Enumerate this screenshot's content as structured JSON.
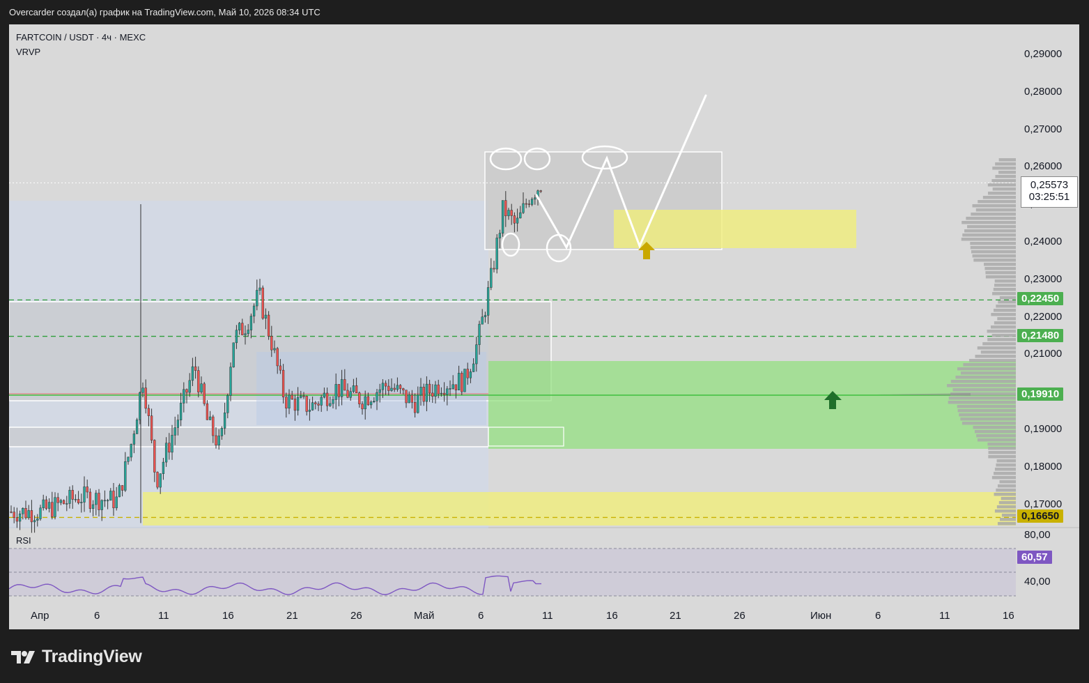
{
  "caption": "Overcarder создал(а) график на TradingView.com, Май 10, 2026 08:34 UTC",
  "symbol_title": "FARTCOIN / USDT · 4ч · MEXC",
  "indicator_label": "VRVP",
  "rsi_label": "RSI",
  "brand": "TradingView",
  "current_price": {
    "value": "0,25573",
    "countdown": "03:25:51"
  },
  "price_tags": [
    {
      "text": "0,22450",
      "price": 0.2245,
      "color": "#4caf50"
    },
    {
      "text": "0,21480",
      "price": 0.2148,
      "color": "#4caf50"
    },
    {
      "text": "0,19910",
      "price": 0.1991,
      "color": "#4caf50"
    },
    {
      "text": "0,16650",
      "price": 0.1665,
      "color": "#c9b100"
    }
  ],
  "rsi_value_tag": {
    "text": "60,57",
    "color": "#7e57c2"
  },
  "rsi_axis": [
    "80,00",
    "40,00"
  ],
  "chart_data": {
    "type": "candlestick",
    "title": "FARTCOIN / USDT · 4ч · MEXC",
    "y_axis_ticks": [
      "0,29000",
      "0,28000",
      "0,27000",
      "0,26000",
      "0,25000",
      "0,24000",
      "0,23000",
      "0,22000",
      "0,21000",
      "0,20000",
      "0,19000",
      "0,18000",
      "0,17000"
    ],
    "y_tick_values": [
      0.29,
      0.28,
      0.27,
      0.26,
      0.25,
      0.24,
      0.23,
      0.22,
      0.21,
      0.2,
      0.19,
      0.18,
      0.17
    ],
    "ylim": [
      0.1625,
      0.2955
    ],
    "x_axis_ticks": [
      "Апр",
      "6",
      "11",
      "16",
      "21",
      "26",
      "Май",
      "6",
      "11",
      "16",
      "21",
      "26",
      "Июн",
      "6",
      "11",
      "16"
    ],
    "price_path": [
      {
        "date": "2026-04-01",
        "close": 0.168
      },
      {
        "date": "2026-04-04",
        "close": 0.172
      },
      {
        "date": "2026-04-07",
        "close": 0.171
      },
      {
        "date": "2026-04-08",
        "close": 0.185
      },
      {
        "date": "2026-04-09",
        "close": 0.204
      },
      {
        "date": "2026-04-10",
        "close": 0.176
      },
      {
        "date": "2026-04-12",
        "close": 0.196
      },
      {
        "date": "2026-04-13",
        "close": 0.207
      },
      {
        "date": "2026-04-14",
        "close": 0.192
      },
      {
        "date": "2026-04-15",
        "close": 0.185
      },
      {
        "date": "2026-04-16",
        "close": 0.214
      },
      {
        "date": "2026-04-17",
        "close": 0.218
      },
      {
        "date": "2026-04-18",
        "close": 0.226
      },
      {
        "date": "2026-04-19",
        "close": 0.213
      },
      {
        "date": "2026-04-20",
        "close": 0.198
      },
      {
        "date": "2026-04-22",
        "close": 0.196
      },
      {
        "date": "2026-04-24",
        "close": 0.201
      },
      {
        "date": "2026-04-26",
        "close": 0.198
      },
      {
        "date": "2026-04-28",
        "close": 0.202
      },
      {
        "date": "2026-04-30",
        "close": 0.197
      },
      {
        "date": "2026-05-02",
        "close": 0.202
      },
      {
        "date": "2026-05-04",
        "close": 0.203
      },
      {
        "date": "2026-05-05",
        "close": 0.213
      },
      {
        "date": "2026-05-06",
        "close": 0.229
      },
      {
        "date": "2026-05-07",
        "close": 0.249
      },
      {
        "date": "2026-05-08",
        "close": 0.244
      },
      {
        "date": "2026-05-09",
        "close": 0.252
      },
      {
        "date": "2026-05-10",
        "close": 0.2557
      }
    ],
    "levels": [
      0.2245,
      0.2148,
      0.1991,
      0.1665
    ],
    "rsi": {
      "last": 60.57,
      "levels": [
        80,
        40
      ]
    },
    "annotations": [
      "drawn W pattern projection",
      "supply box 0.238-0.264",
      "demand zone 0.185-0.208"
    ]
  }
}
